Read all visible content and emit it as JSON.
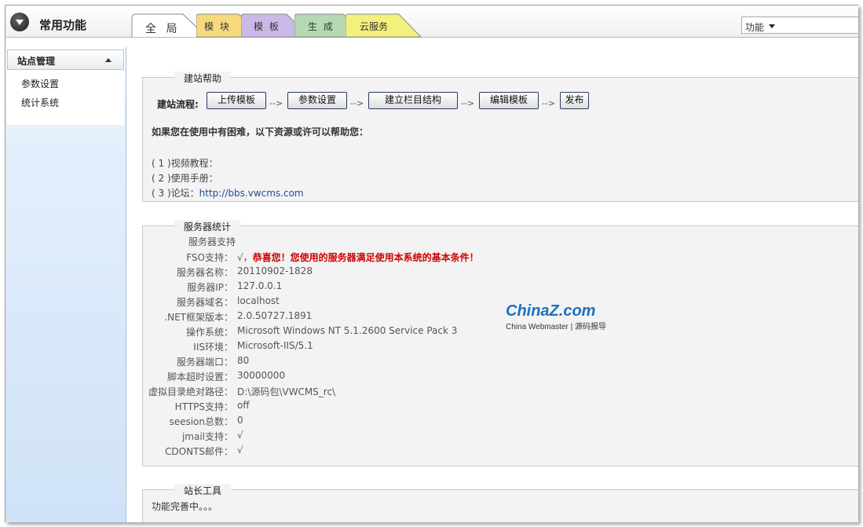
{
  "header": {
    "title": "常用功能",
    "tabs": [
      {
        "label": "全 局",
        "color": "#ffffff",
        "active": true
      },
      {
        "label": "模 块",
        "color": "#f6d97d"
      },
      {
        "label": "模 板",
        "color": "#c9b9e6"
      },
      {
        "label": "生 成",
        "color": "#b5d9b2"
      },
      {
        "label": "云服务",
        "color": "#f4f07c"
      }
    ],
    "function_select": "功能"
  },
  "sidebar": {
    "section": "站点管理",
    "items": [
      {
        "label": "参数设置"
      },
      {
        "label": "统计系统"
      }
    ]
  },
  "help_panel": {
    "legend": "建站帮助",
    "flow_label": "建站流程:",
    "steps": [
      "上传模板",
      "参数设置",
      "建立栏目结构",
      "编辑模板",
      "发布"
    ],
    "arrow": "-->",
    "help_title": "如果您在使用中有困难，以下资源或许可以帮助您：",
    "resources": [
      {
        "prefix": "( 1 )",
        "label": "视频教程：",
        "link": ""
      },
      {
        "prefix": "( 2 )",
        "label": "使用手册：",
        "link": ""
      },
      {
        "prefix": "( 3 )",
        "label": "论坛：",
        "link": "http://bbs.vwcms.com"
      }
    ]
  },
  "server_panel": {
    "legend": "服务器统计",
    "heading": "服务器支持",
    "rows": [
      {
        "key": "FSO支持：",
        "check": "√，",
        "value": "恭喜您！您使用的服务器满足使用本系统的基本条件！"
      },
      {
        "key": "服务器名称：",
        "value": "20110902-1828"
      },
      {
        "key": "服务器IP：",
        "value": "127.0.0.1"
      },
      {
        "key": "服务器域名：",
        "value": "localhost"
      },
      {
        "key": ".NET框架版本：",
        "value": "2.0.50727.1891"
      },
      {
        "key": "操作系统：",
        "value": "Microsoft Windows NT 5.1.2600 Service Pack 3"
      },
      {
        "key": "IIS环境：",
        "value": "Microsoft-IIS/5.1"
      },
      {
        "key": "服务器端口：",
        "value": "80"
      },
      {
        "key": "脚本超时设置：",
        "value": "30000000"
      },
      {
        "key": "虚拟目录绝对路径：",
        "value": "D:\\源码包\\VWCMS_rc\\"
      },
      {
        "key": "HTTPS支持：",
        "value": "off"
      },
      {
        "key": "seesion总数：",
        "value": "0"
      },
      {
        "key": "jmail支持：",
        "value": "√"
      },
      {
        "key": "CDONTS邮件：",
        "value": "√"
      }
    ]
  },
  "tools_panel": {
    "legend": "站长工具",
    "text": "功能完善中。。。"
  },
  "watermark": {
    "brand": "ChinaZ.com",
    "sub": "China Webmaster | 源码报导"
  }
}
